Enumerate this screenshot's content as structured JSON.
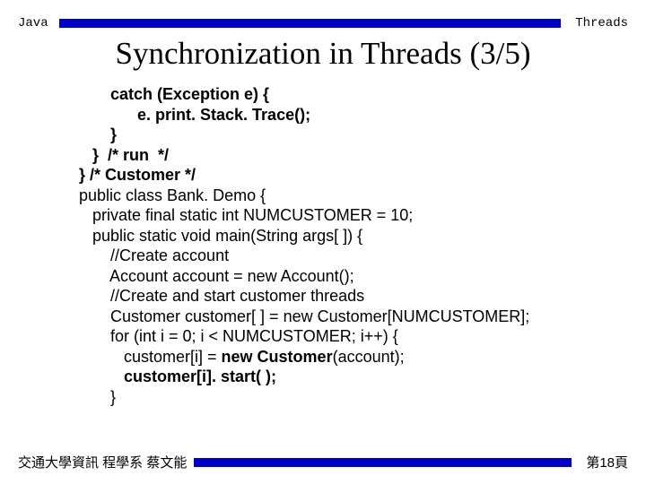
{
  "header": {
    "left": "Java",
    "right": "Threads"
  },
  "title": "Synchronization in Threads (3/5)",
  "code": {
    "l1": "       catch (Exception e) {",
    "l2": "             e. print. Stack. Trace();",
    "l3": "       }",
    "l4": "   }  /* run  */",
    "l5": "} /* Customer */",
    "l6": "public class Bank. Demo {",
    "l7": "   private final static int NUMCUSTOMER = 10;",
    "l8": "   public static void main(String args[ ]) {",
    "l9": "       //Create account",
    "l10": "       Account account = new Account();",
    "l11": "       //Create and start customer threads",
    "l12": "       Customer customer[ ] = new Customer[NUMCUSTOMER];",
    "l13": "       for (int i = 0; i < NUMCUSTOMER; i++) {",
    "l14a": "          customer[i] = ",
    "l14b": "new Customer",
    "l14c": "(account);",
    "l15a": "          ",
    "l15b": "customer[i]. start( );",
    "l16": "       }"
  },
  "footer": {
    "left": "交通大學資訊 程學系 蔡文能",
    "right": "第18頁"
  }
}
